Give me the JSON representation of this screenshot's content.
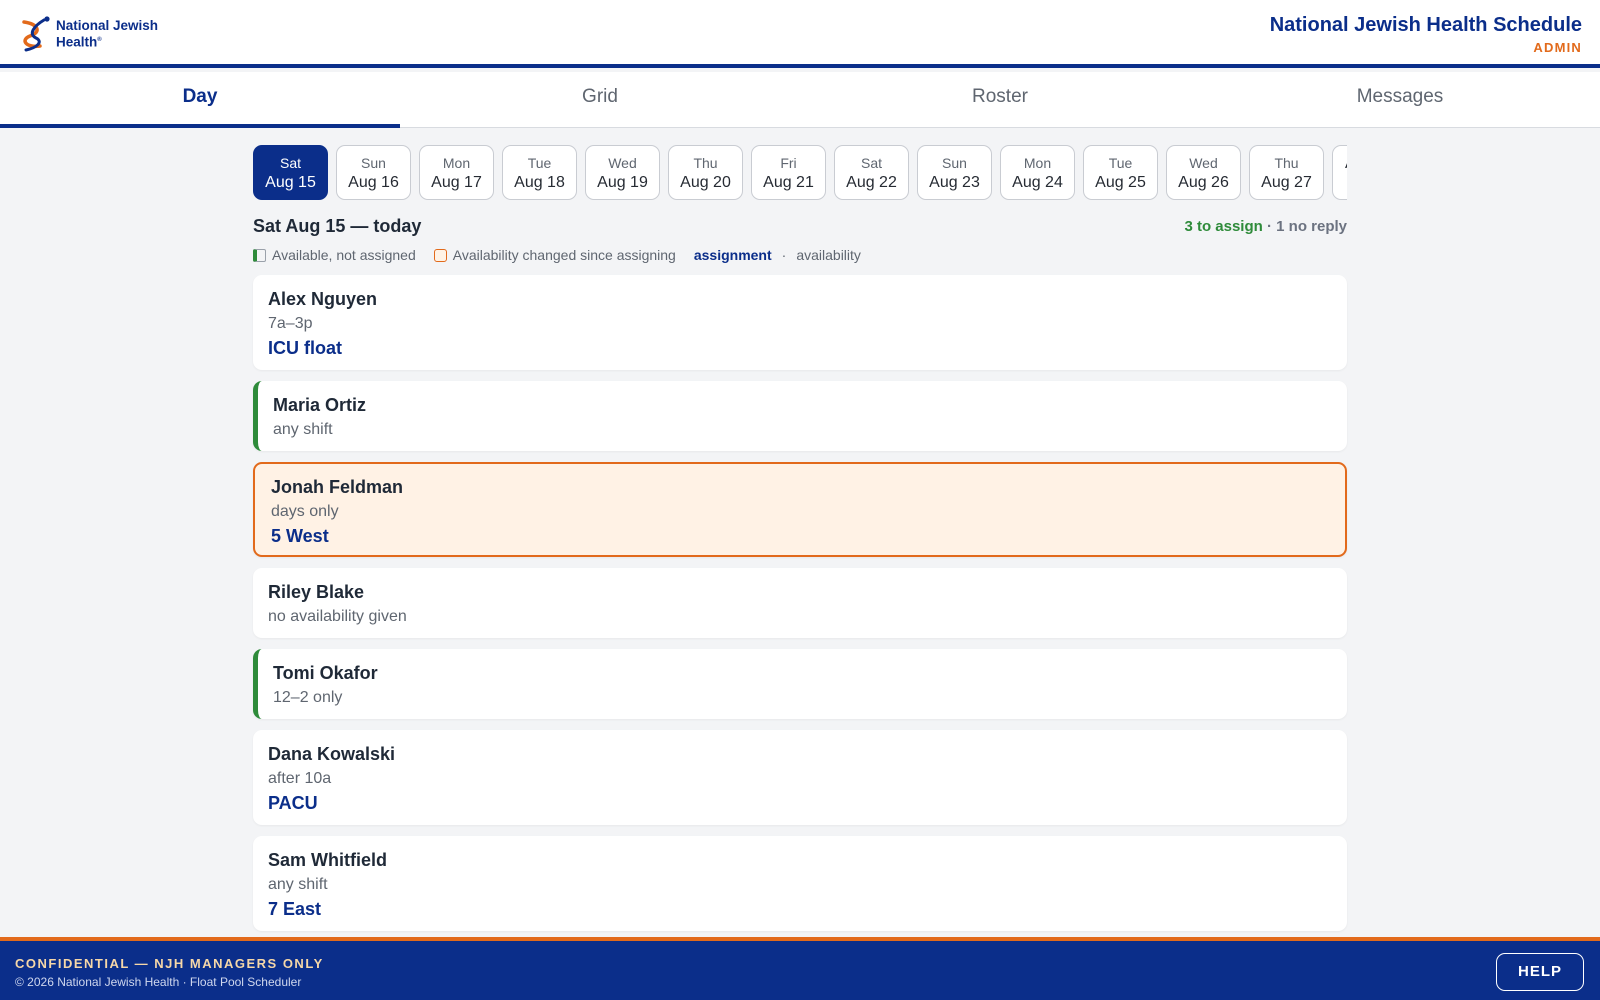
{
  "header": {
    "logo_line1": "National Jewish",
    "logo_line2": "Health",
    "title": "National Jewish Health Schedule",
    "role": "ADMIN",
    "colors": {
      "brand_blue": "#0b2e8a",
      "brand_orange": "#e26a1b"
    }
  },
  "tabs": [
    {
      "label": "Day",
      "active": true
    },
    {
      "label": "Grid"
    },
    {
      "label": "Roster"
    },
    {
      "label": "Messages"
    }
  ],
  "dates": [
    {
      "dow": "Sat",
      "dm": "Aug 15",
      "selected": true
    },
    {
      "dow": "Sun",
      "dm": "Aug 16"
    },
    {
      "dow": "Mon",
      "dm": "Aug 17"
    },
    {
      "dow": "Tue",
      "dm": "Aug 18"
    },
    {
      "dow": "Wed",
      "dm": "Aug 19"
    },
    {
      "dow": "Thu",
      "dm": "Aug 20"
    },
    {
      "dow": "Fri",
      "dm": "Aug 21"
    },
    {
      "dow": "Sat",
      "dm": "Aug 22"
    },
    {
      "dow": "Sun",
      "dm": "Aug 23"
    },
    {
      "dow": "Mon",
      "dm": "Aug 24"
    },
    {
      "dow": "Tue",
      "dm": "Aug 25"
    },
    {
      "dow": "Wed",
      "dm": "Aug 26"
    },
    {
      "dow": "Thu",
      "dm": "Aug 27"
    },
    {
      "dow": "",
      "dm": "A"
    }
  ],
  "day": {
    "title": "Sat Aug 15 — today",
    "to_assign": "3 to assign",
    "sep": " · ",
    "no_reply": "1 no reply"
  },
  "legend": {
    "available_label": "Available, not assigned",
    "changed_label": "Availability changed since assigning",
    "assignment": "assignment",
    "dot": "·",
    "availability": "availability"
  },
  "people": [
    {
      "name": "Alex Nguyen",
      "availability": "7a–3p",
      "assignment": "ICU float",
      "status": "assigned"
    },
    {
      "name": "Maria Ortiz",
      "availability": "any shift",
      "assignment": "",
      "status": "available"
    },
    {
      "name": "Jonah Feldman",
      "availability": "days only",
      "assignment": "5 West",
      "status": "changed"
    },
    {
      "name": "Riley Blake",
      "availability": "no availability given",
      "assignment": "",
      "status": "none"
    },
    {
      "name": "Tomi Okafor",
      "availability": "12–2 only",
      "assignment": "",
      "status": "available"
    },
    {
      "name": "Dana Kowalski",
      "availability": "after 10a",
      "assignment": "PACU",
      "status": "assigned"
    },
    {
      "name": "Sam Whitfield",
      "availability": "any shift",
      "assignment": "7 East",
      "status": "assigned"
    }
  ],
  "footer": {
    "confidential": "CONFIDENTIAL — NJH MANAGERS ONLY",
    "copyright": "© 2026 National Jewish Health · Float Pool Scheduler",
    "help": "HELP"
  }
}
